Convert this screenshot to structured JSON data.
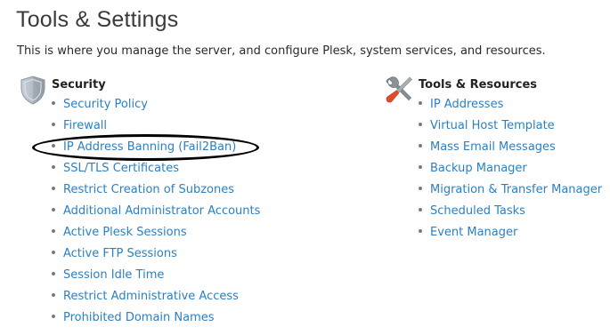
{
  "page": {
    "title": "Tools & Settings",
    "description": "This is where you manage the server, and configure Plesk, system services, and resources."
  },
  "security": {
    "heading": "Security",
    "icon": "shield-icon",
    "items": [
      {
        "label": "Security Policy"
      },
      {
        "label": "Firewall"
      },
      {
        "label": "IP Address Banning (Fail2Ban)"
      },
      {
        "label": "SSL/TLS Certificates"
      },
      {
        "label": "Restrict Creation of Subzones"
      },
      {
        "label": "Additional Administrator Accounts"
      },
      {
        "label": "Active Plesk Sessions"
      },
      {
        "label": "Active FTP Sessions"
      },
      {
        "label": "Session Idle Time"
      },
      {
        "label": "Restrict Administrative Access"
      },
      {
        "label": "Prohibited Domain Names"
      }
    ]
  },
  "tools": {
    "heading": "Tools & Resources",
    "icon": "tools-icon",
    "items": [
      {
        "label": "IP Addresses"
      },
      {
        "label": "Virtual Host Template"
      },
      {
        "label": "Mass Email Messages"
      },
      {
        "label": "Backup Manager"
      },
      {
        "label": "Migration & Transfer Manager"
      },
      {
        "label": "Scheduled Tasks"
      },
      {
        "label": "Event Manager"
      }
    ]
  },
  "colors": {
    "link": "#2d7fbf",
    "heading": "#222222",
    "title": "#3a3a3a",
    "highlight": "#000000"
  }
}
